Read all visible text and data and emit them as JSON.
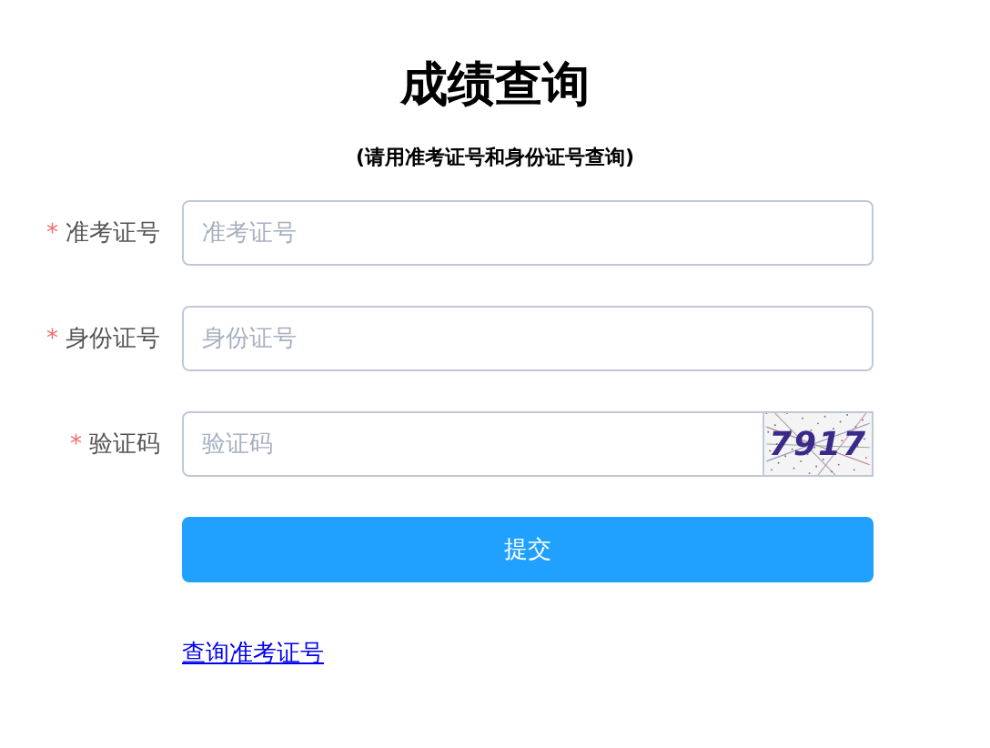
{
  "title": "成绩查询",
  "subtitle": "(请用准考证号和身份证号查询)",
  "fields": [
    {
      "kind": "text",
      "required_mark": "*",
      "label": "准考证号",
      "placeholder": "准考证号"
    },
    {
      "kind": "text",
      "required_mark": "*",
      "label": "身份证号",
      "placeholder": "身份证号"
    },
    {
      "kind": "captcha",
      "required_mark": "*",
      "label": "验证码",
      "placeholder": "验证码",
      "captcha": "7917"
    }
  ],
  "submit": "提交",
  "link": "查询准考证号"
}
